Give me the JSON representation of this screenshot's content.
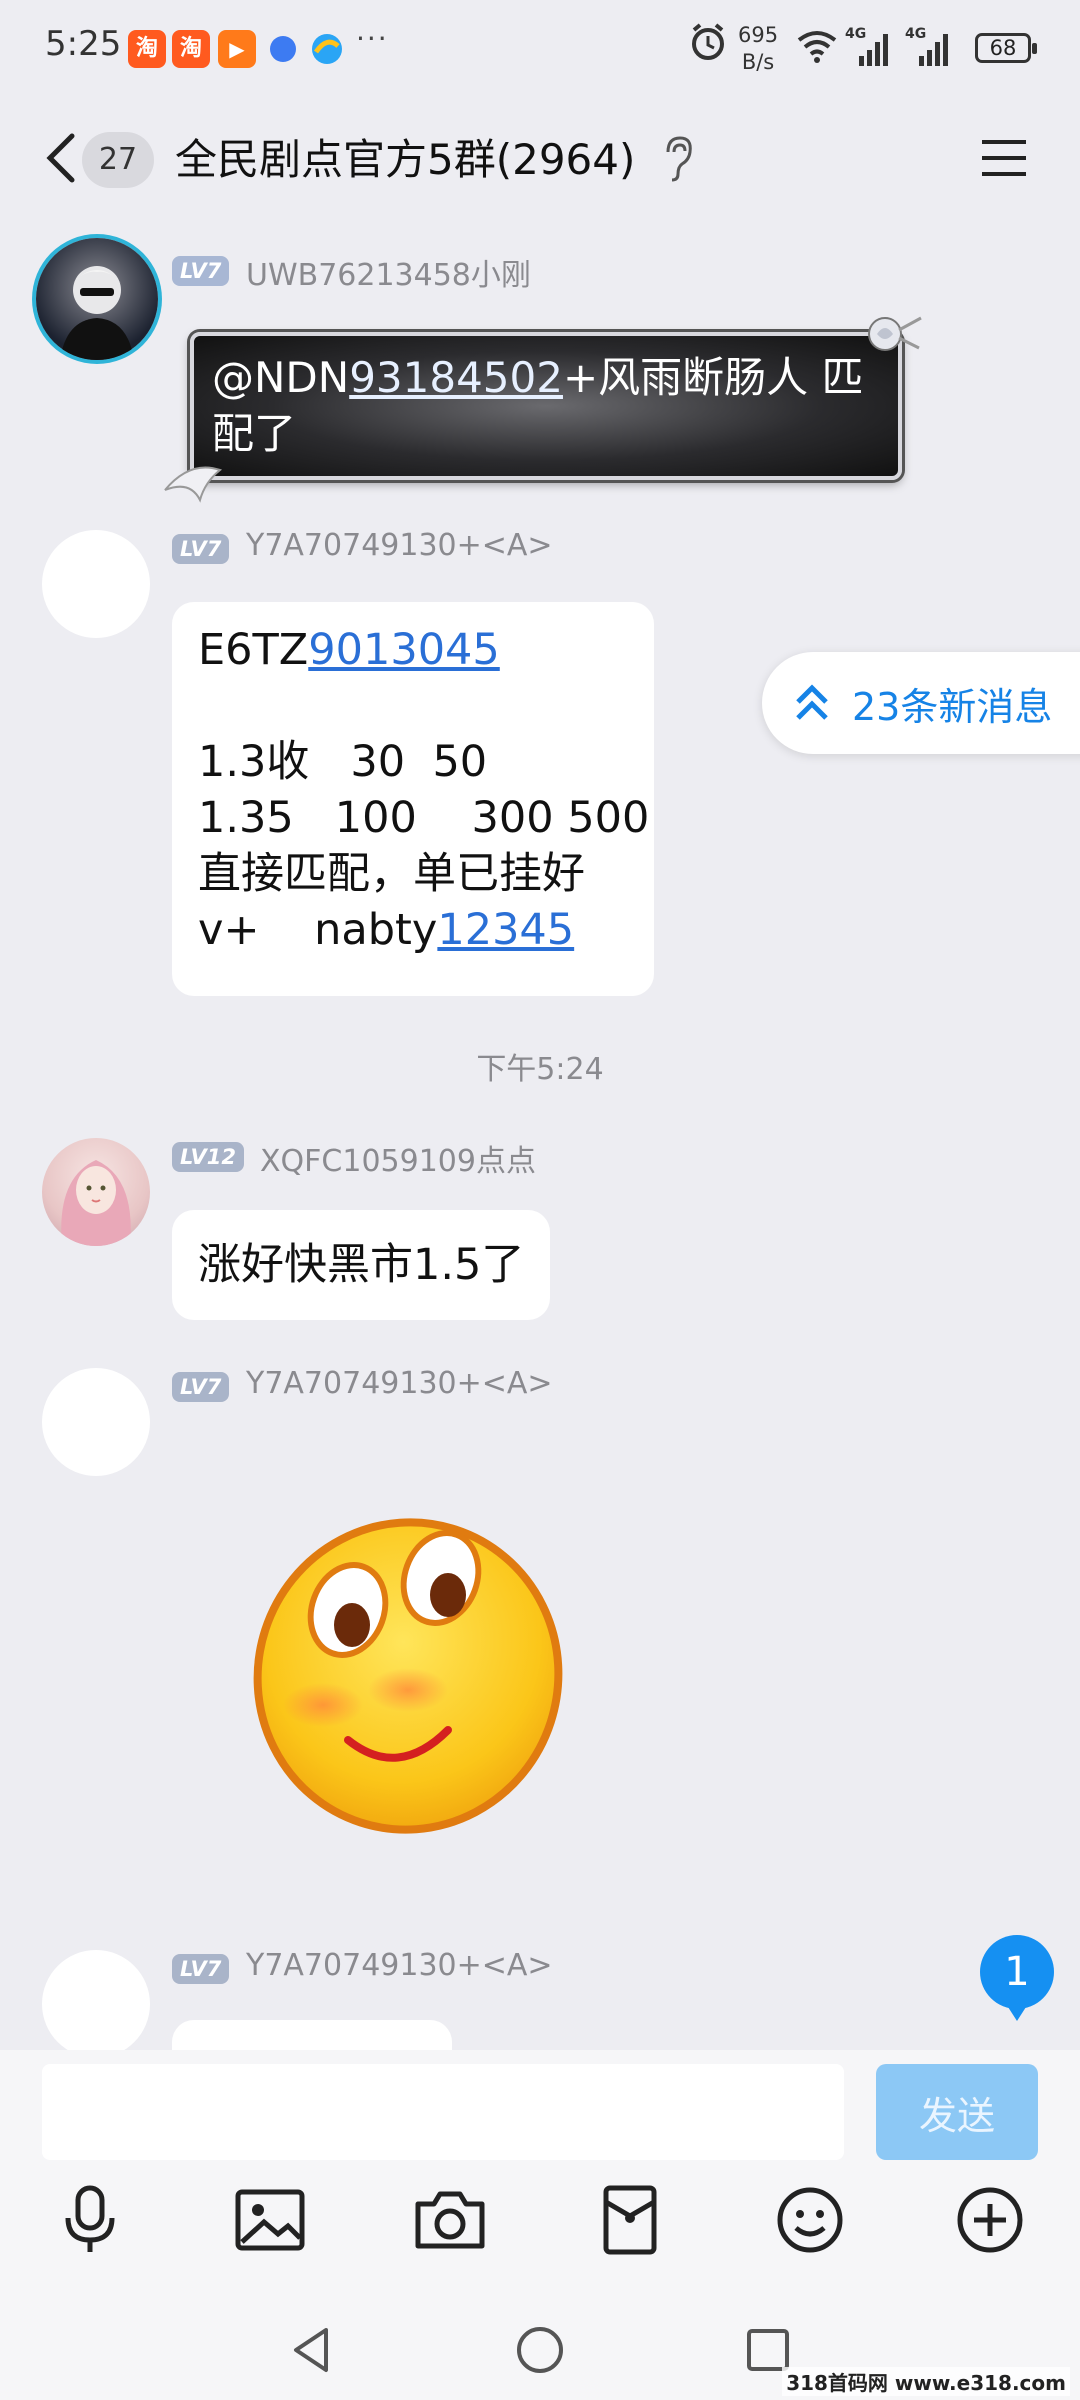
{
  "status_bar": {
    "time": "5:25",
    "app_icons": [
      {
        "name": "taobao-icon",
        "glyph": "淘",
        "color": "#ff5a1f"
      },
      {
        "name": "taobao-icon",
        "glyph": "淘",
        "color": "#ff5a1f"
      },
      {
        "name": "video-app-icon",
        "glyph": "▶",
        "color": "#ff7a1a"
      },
      {
        "name": "blue-dot-icon",
        "glyph": "",
        "color": "#3d7bf2"
      },
      {
        "name": "browser-icon",
        "glyph": "",
        "color": "#2aa5f5"
      }
    ],
    "more": "···",
    "net_speed_value": "695",
    "net_speed_unit": "B/s",
    "network_label_1": "4G",
    "network_label_2": "4G",
    "battery": "68"
  },
  "header": {
    "back_icon": "chevron-left-icon",
    "unread_count": "27",
    "title": "全民剧点官方5群(2964)",
    "earpiece_icon": "ear-icon",
    "menu_icon": "hamburger-menu-icon"
  },
  "messages": [
    {
      "level": "LV7",
      "sender": "UWB76213458小刚",
      "parts": [
        "@NDN",
        "93184502",
        "+风雨断肠人 匹配了"
      ]
    },
    {
      "level": "LV7",
      "sender": "Y7A70749130+<A>",
      "line1_a": "E6TZ",
      "line1_link": "9013045",
      "line2": "1.3收   30  50",
      "line3": "1.35   100    300 500",
      "line4": "直接匹配，单已挂好",
      "line5_a": "v+    nabty",
      "line5_link": "12345"
    },
    {
      "timestamp": "下午5:24"
    },
    {
      "level": "LV12",
      "sender": "XQFC1059109点点",
      "text": "涨好快黑市1.5了"
    },
    {
      "level": "LV7",
      "sender": "Y7A70749130+<A>",
      "sticker": "smiley-sticker-icon"
    },
    {
      "level": "LV7",
      "sender": "Y7A70749130+<A>"
    }
  ],
  "new_messages_pill": "23条新消息",
  "float_unread": "1",
  "input": {
    "placeholder": "",
    "send_label": "发送"
  },
  "toolbar": [
    "mic-icon",
    "image-icon",
    "camera-icon",
    "red-packet-icon",
    "emoji-icon",
    "plus-icon"
  ],
  "nav": [
    "back-triangle-icon",
    "home-circle-icon",
    "recents-square-icon"
  ],
  "watermark": "318首码网 www.e318.com",
  "colors": {
    "background": "#ededf2",
    "link": "#2a6fd6",
    "accent": "#1683e6",
    "send_disabled": "#8cc8f5"
  }
}
